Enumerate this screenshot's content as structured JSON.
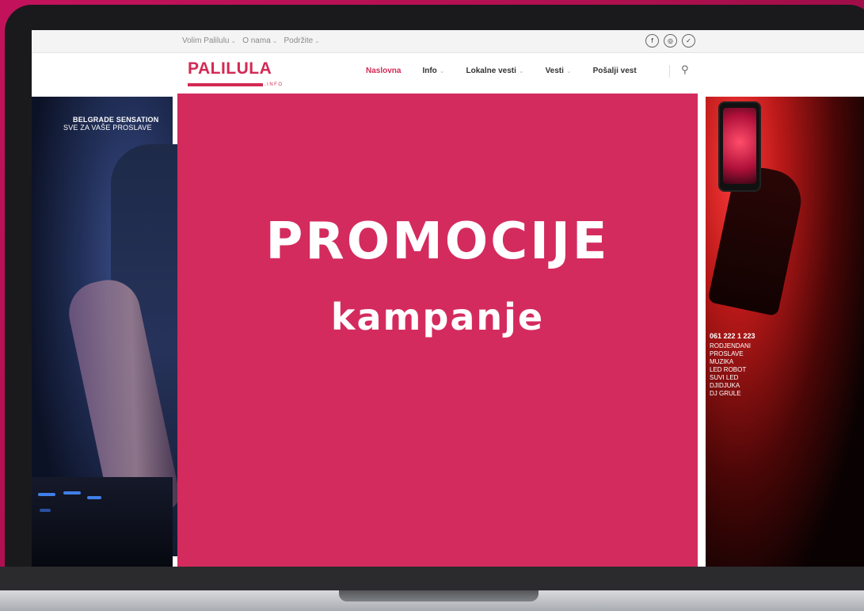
{
  "topbar": {
    "nav": [
      "Volim Palilulu",
      "O nama",
      "Podržite"
    ],
    "social_icons": [
      "facebook-icon",
      "instagram-icon",
      "twitter-icon"
    ],
    "social_glyphs": [
      "f",
      "◎",
      "✓"
    ]
  },
  "header": {
    "logo": "PALILULA",
    "logo_suffix": ".INFO",
    "nav": [
      {
        "label": "Naslovna",
        "active": true
      },
      {
        "label": "Info",
        "dropdown": true
      },
      {
        "label": "Lokalne vesti",
        "dropdown": true
      },
      {
        "label": "Vesti",
        "dropdown": true
      },
      {
        "label": "Pošalji vest"
      }
    ],
    "search_icon": "search-icon"
  },
  "left_ad": {
    "title": "BELGRADE SENSATION",
    "subtitle": "SVE ZA VAŠE PROSLAVE"
  },
  "right_ad": {
    "phone": "061 222 1 223",
    "services": [
      "RODJENDANI",
      "PROSLAVE",
      "MUZIKA",
      "LED ROBOT",
      "SUVI LED",
      "DJIDJUKA",
      "DJ GRULE"
    ]
  },
  "promo": {
    "title": "PROMOCIJE",
    "subtitle": "kampanje"
  },
  "colors": {
    "brand": "#d32954",
    "promo_bg": "#d42b5e",
    "background": "#c3125c"
  }
}
